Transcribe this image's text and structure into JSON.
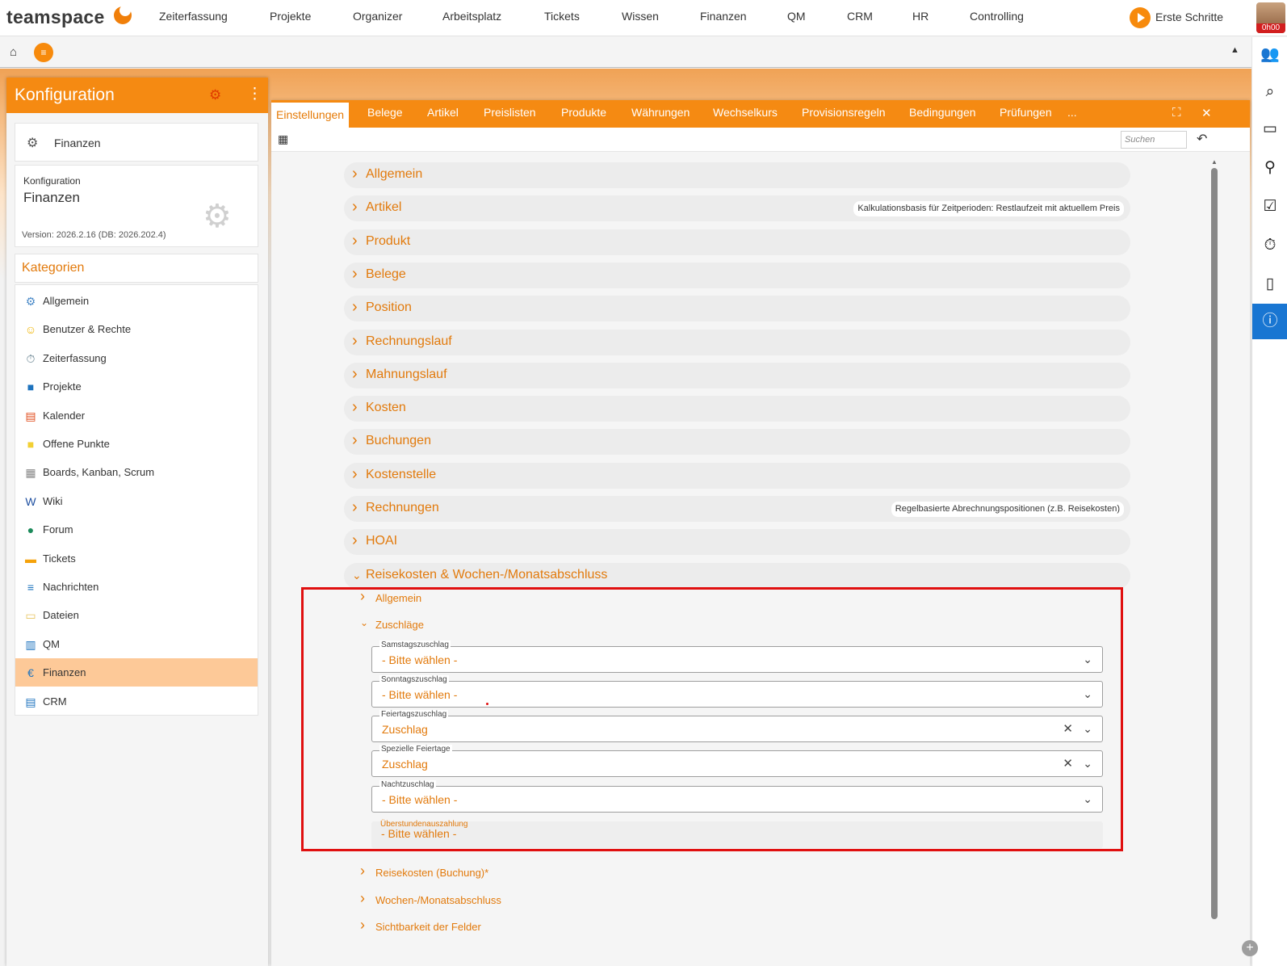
{
  "app": {
    "logo": "teamspace"
  },
  "topnav": {
    "items": [
      "Zeiterfassung",
      "Projekte",
      "Organizer",
      "Arbeitsplatz",
      "Tickets",
      "Wissen",
      "Finanzen",
      "QM",
      "CRM",
      "HR",
      "Controlling"
    ],
    "first_steps": "Erste Schritte",
    "timer": "0h00"
  },
  "left": {
    "header": "Konfiguration",
    "module": "Finanzen",
    "config_label": "Konfiguration",
    "config_value": "Finanzen",
    "version": "Version: 2026.2.16 (DB: 2026.202.4)",
    "categories_title": "Kategorien",
    "categories": [
      {
        "label": "Allgemein",
        "icon": "gears-icon",
        "color": "#4a8ac8"
      },
      {
        "label": "Benutzer & Rechte",
        "icon": "users-icon",
        "color": "#f0b400"
      },
      {
        "label": "Zeiterfassung",
        "icon": "stopwatch-icon",
        "color": "#607d8b"
      },
      {
        "label": "Projekte",
        "icon": "folder-icon",
        "color": "#1e73be"
      },
      {
        "label": "Kalender",
        "icon": "calendar-icon",
        "color": "#e04a1a"
      },
      {
        "label": "Offene Punkte",
        "icon": "sticky-note-icon",
        "color": "#f2d034"
      },
      {
        "label": "Boards, Kanban, Scrum",
        "icon": "board-icon",
        "color": "#888888"
      },
      {
        "label": "Wiki",
        "icon": "wiki-icon",
        "color": "#1e4fa0"
      },
      {
        "label": "Forum",
        "icon": "globe-icon",
        "color": "#1b8a5a"
      },
      {
        "label": "Tickets",
        "icon": "ticket-icon",
        "color": "#f5a20a"
      },
      {
        "label": "Nachrichten",
        "icon": "news-icon",
        "color": "#1e73be"
      },
      {
        "label": "Dateien",
        "icon": "files-icon",
        "color": "#e8c560"
      },
      {
        "label": "QM",
        "icon": "qm-book-icon",
        "color": "#1e73be"
      },
      {
        "label": "Finanzen",
        "icon": "euro-icon",
        "color": "#1e73be"
      },
      {
        "label": "CRM",
        "icon": "contact-card-icon",
        "color": "#1e73be"
      }
    ],
    "active_category": "Finanzen"
  },
  "tabs": [
    "Einstellungen",
    "Belege",
    "Artikel",
    "Preislisten",
    "Produkte",
    "Währungen",
    "Wechselkurs",
    "Provisionsregeln",
    "Bedingungen",
    "Prüfungen",
    "..."
  ],
  "search": {
    "placeholder": "Suchen"
  },
  "sections": [
    {
      "title": "Allgemein",
      "hint": ""
    },
    {
      "title": "Artikel",
      "hint": "Kalkulationsbasis für Zeitperioden: Restlaufzeit mit aktuellem Preis"
    },
    {
      "title": "Produkt",
      "hint": ""
    },
    {
      "title": "Belege",
      "hint": ""
    },
    {
      "title": "Position",
      "hint": ""
    },
    {
      "title": "Rechnungslauf",
      "hint": ""
    },
    {
      "title": "Mahnungslauf",
      "hint": ""
    },
    {
      "title": "Kosten",
      "hint": ""
    },
    {
      "title": "Buchungen",
      "hint": ""
    },
    {
      "title": "Kostenstelle",
      "hint": ""
    },
    {
      "title": "Rechnungen",
      "hint": "Regelbasierte Abrechnungspositionen (z.B. Reisekosten)"
    },
    {
      "title": "HOAI",
      "hint": ""
    },
    {
      "title": "Reisekosten & Wochen-/Monatsabschluss",
      "hint": ""
    }
  ],
  "subsections": {
    "allgemein": "Allgemein",
    "zuschlaege": "Zuschläge",
    "reisekosten": "Reisekosten (Buchung)*",
    "wochen": "Wochen-/Monatsabschluss",
    "sichtbarkeit": "Sichtbarkeit der Felder"
  },
  "fields": [
    {
      "label": "Samstagszuschlag",
      "value": "- Bitte wählen -"
    },
    {
      "label": "Sonntagszuschlag",
      "value": "- Bitte wählen -"
    },
    {
      "label": "Feiertagszuschlag",
      "value": "Zuschlag"
    },
    {
      "label": "Spezielle Feiertage",
      "value": "Zuschlag"
    },
    {
      "label": "Nachtzuschlag",
      "value": "- Bitte wählen -"
    },
    {
      "label": "Überstundenauszahlung",
      "value": "- Bitte wählen -"
    }
  ],
  "colors": {
    "brand": "#f58a12",
    "accent_text": "#e27a0c",
    "highlight": "#e01010",
    "active_info": "#1976d2"
  }
}
